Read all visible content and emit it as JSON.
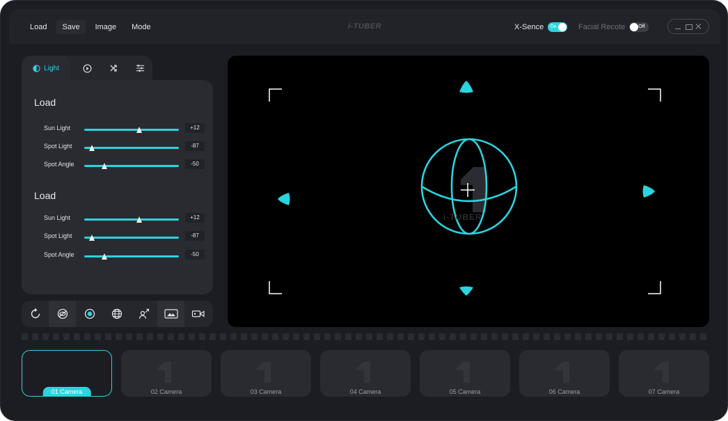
{
  "menu": {
    "items": [
      "Load",
      "Save",
      "Image",
      "Mode"
    ],
    "active_index": 1
  },
  "brand": "i-TUBER",
  "toggles": {
    "xsence": {
      "label": "X-Sence",
      "state": "On"
    },
    "facial": {
      "label": "Facial Recote",
      "state": "Off"
    }
  },
  "tabs": {
    "active_label": "Light"
  },
  "sections": [
    {
      "title": "Load",
      "sliders": [
        {
          "label": "Sun Light",
          "value": "+12",
          "level": 0.58
        },
        {
          "label": "Spot Light",
          "value": "-87",
          "level": 0.08
        },
        {
          "label": "Spot Angle",
          "value": "-50",
          "level": 0.21
        }
      ]
    },
    {
      "title": "Load",
      "sliders": [
        {
          "label": "Sun Light",
          "value": "+12",
          "level": 0.58
        },
        {
          "label": "Spot Light",
          "value": "-87",
          "level": 0.08
        },
        {
          "label": "Spot Angle",
          "value": "-50",
          "level": 0.21
        }
      ]
    }
  ],
  "viewport": {
    "watermark": "i-TUBER"
  },
  "cameras": [
    "01 Camera",
    "02 Camera",
    "03 Camera",
    "04 Camera",
    "05 Camera",
    "06 Camera",
    "07 Camera"
  ],
  "active_camera": 0,
  "colors": {
    "accent": "#2bd4df",
    "background": "#1c1d22",
    "panel": "#2a2b31",
    "viewport": "#000000"
  }
}
